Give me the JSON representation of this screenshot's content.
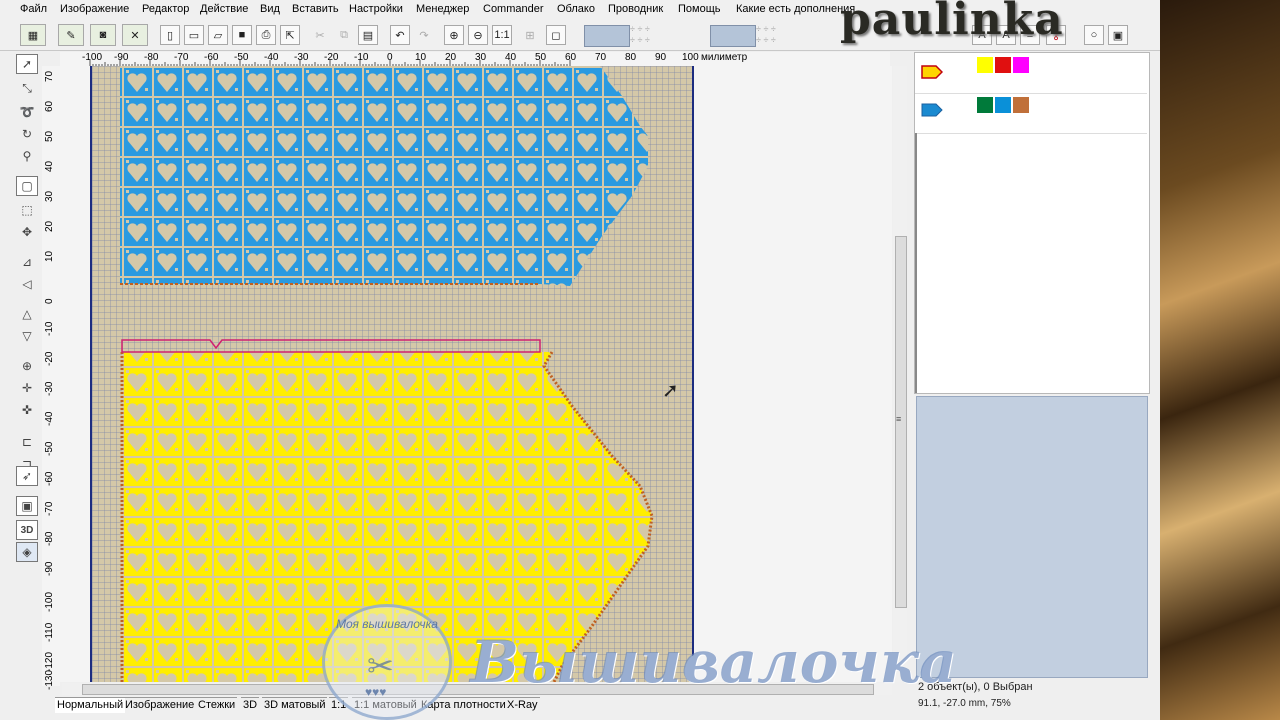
{
  "menu": [
    "Файл",
    "Изображение",
    "Редактор",
    "Действие",
    "Вид",
    "Вставить",
    "Настройки",
    "Менеджер",
    "Commander",
    "Облако",
    "Проводник",
    "Помощь",
    "Какие есть дополнения"
  ],
  "ruler": {
    "unit": "милиметр",
    "x_ticks": [
      "-100",
      "-90",
      "-80",
      "-70",
      "-60",
      "-50",
      "-40",
      "-30",
      "-20",
      "-10",
      "0",
      "10",
      "20",
      "30",
      "40",
      "50",
      "60",
      "70",
      "80",
      "90",
      "100"
    ],
    "y_ticks": [
      "70",
      "60",
      "50",
      "40",
      "30",
      "20",
      "10",
      "0",
      "-10",
      "-20",
      "-30",
      "-40",
      "-50",
      "-60",
      "-70",
      "-80",
      "-90",
      "-100",
      "-110",
      "-120",
      "-130"
    ]
  },
  "objects": [
    {
      "thread_color": "#ffd400",
      "swatches": [
        "#ffff00",
        "#e01010",
        "#ff00ff"
      ]
    },
    {
      "thread_color": "#1a8ad0",
      "swatches": [
        "#007a3a",
        "#0a90d8",
        "#c0703a"
      ]
    }
  ],
  "design": {
    "top_fill_color": "#2a9ae0",
    "bottom_fill_color": "#ffee00",
    "outline_color": "#d02070",
    "border_color": "#c06020"
  },
  "view_tabs": [
    "Нормальный",
    "Изображение",
    "Стежки",
    "3D",
    "3D матовый",
    "1:1",
    "1:1 матовый",
    "Карта плотности",
    "X-Ray"
  ],
  "status": {
    "selection": "2 объект(ы), 0 Выбран",
    "coords": "91.1, -27.0 mm, 75%"
  },
  "watermarks": {
    "author": "paulinka",
    "brand": "Вышивалочка",
    "seal": "Моя вышивалочка"
  }
}
